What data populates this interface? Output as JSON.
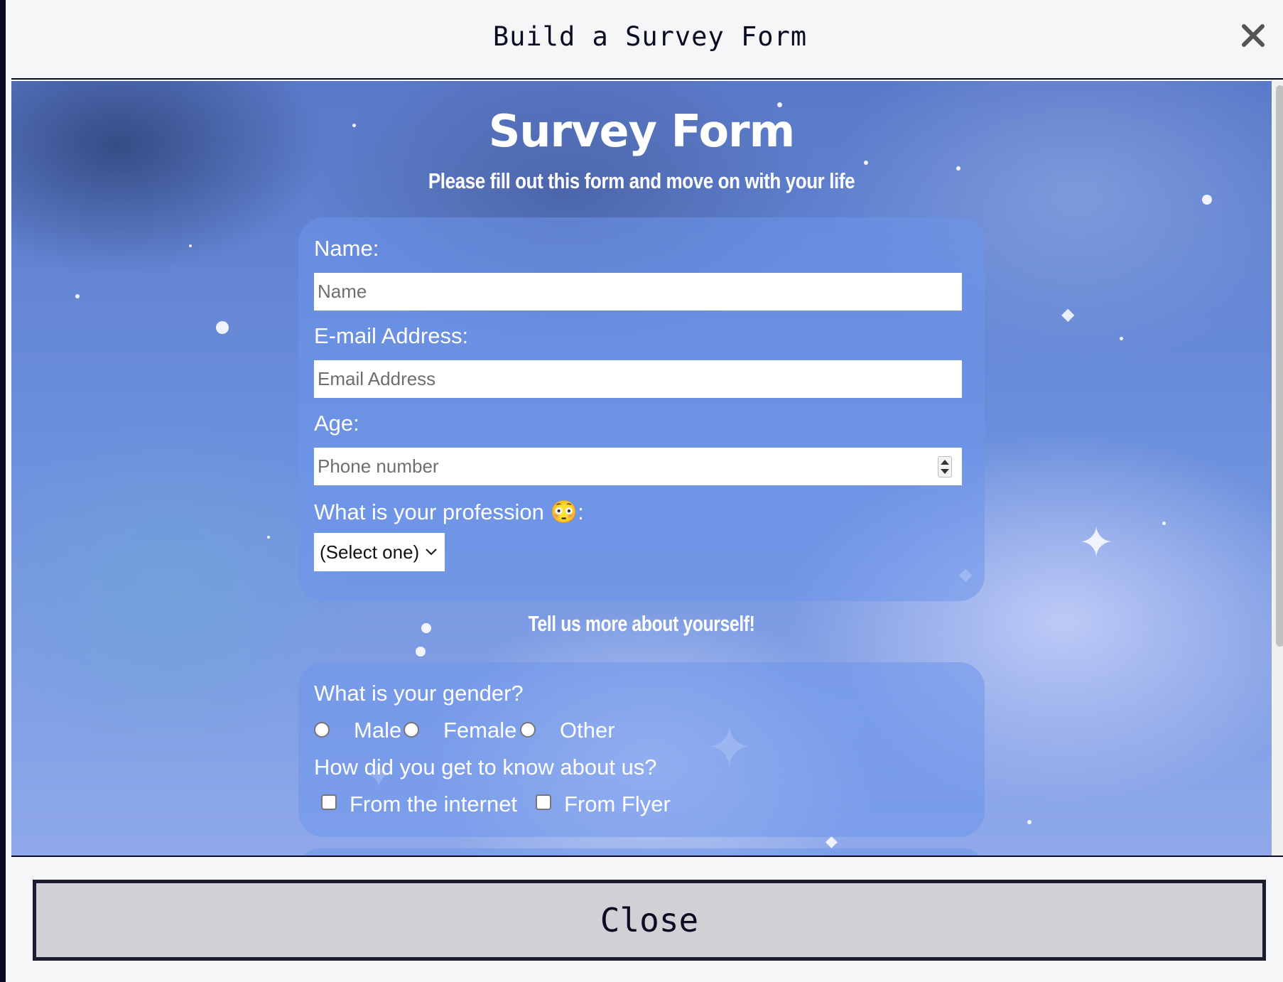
{
  "modal": {
    "title": "Build a Survey Form",
    "close_button_label": "Close"
  },
  "page": {
    "title": "Survey Form",
    "subtitle": "Please fill out this form and move on with your life",
    "section_title": "Tell us more about yourself!"
  },
  "form": {
    "name_label": "Name:",
    "name_placeholder": "Name",
    "email_label": "E-mail Address:",
    "email_placeholder": "Email Address",
    "age_label": "Age:",
    "age_placeholder": "Phone number",
    "profession_label": "What is your profession 😳:",
    "profession_select_value": "(Select one)",
    "gender_question": "What is your gender?",
    "gender_options": [
      "Male",
      "Female",
      "Other"
    ],
    "source_question": "How did you get to know about us?",
    "source_options": [
      "From the internet",
      "From Flyer"
    ]
  },
  "colors": {
    "dark_navy": "#0a0a23",
    "modal_bg": "#f5f6f7",
    "close_button_bg": "#d0d0d5",
    "panel_bg": "rgba(110,150,235,0.55)",
    "text_white": "#ffffff"
  },
  "icons": {
    "close": "close-x-icon",
    "dropdown": "chevron-down-icon",
    "spinner": "spinner-arrows-icon"
  }
}
